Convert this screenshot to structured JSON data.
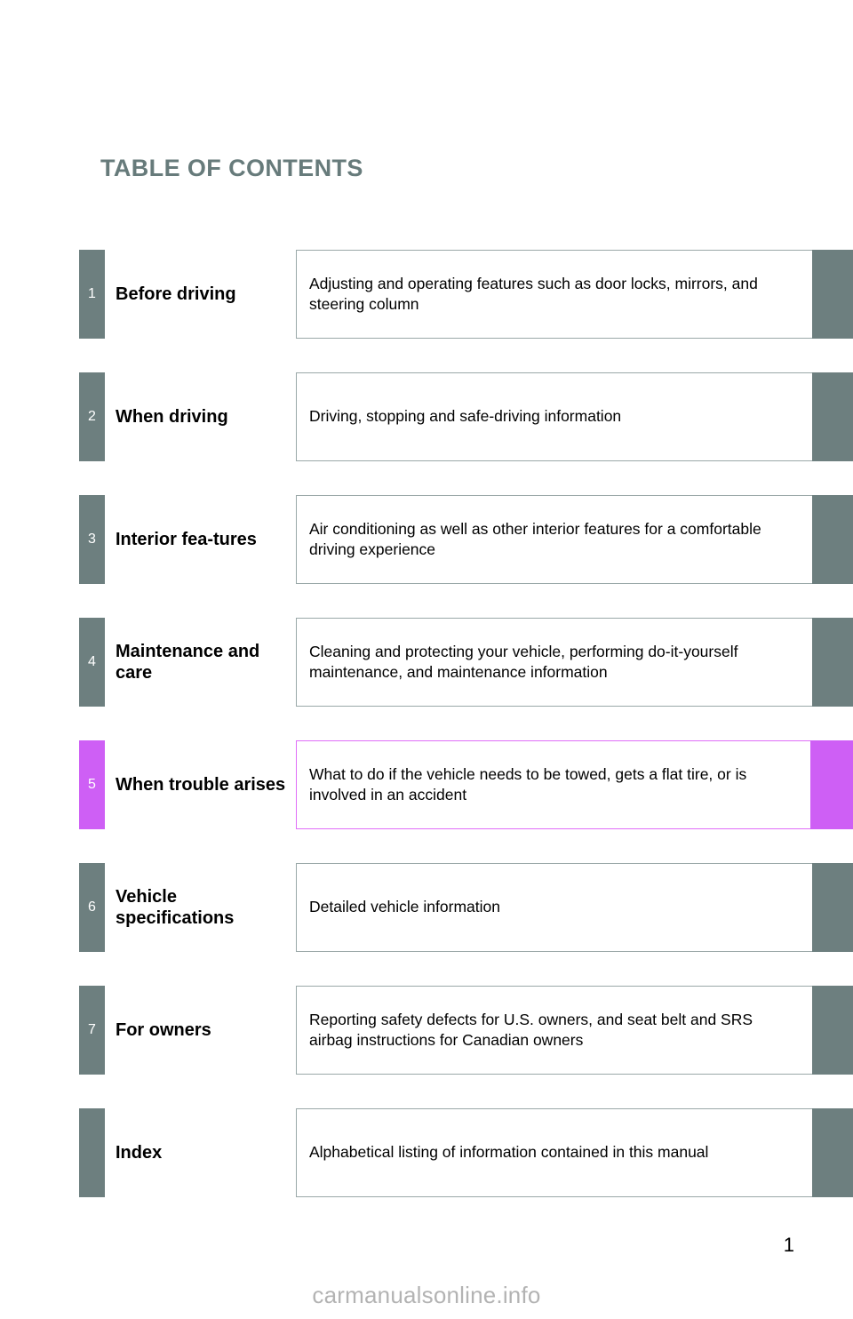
{
  "page": {
    "title": "TABLE OF CONTENTS",
    "number": "1",
    "watermark": "carmanualsonline.info"
  },
  "colors": {
    "tab_gray": "#6d7f7f",
    "tab_highlight": "#ce5ff5",
    "title_gray": "#677b7b",
    "box_border": "#9aa8a8",
    "box_border_highlight": "#e06ef8",
    "text_black": "#000000",
    "watermark_gray": "#b3b3b3"
  },
  "contents": [
    {
      "number": "1",
      "chapter": "Before driving",
      "description": "Adjusting and operating features such as door locks, mirrors, and steering column",
      "highlighted": false
    },
    {
      "number": "2",
      "chapter": "When driving",
      "description": "Driving, stopping and safe-driving information",
      "highlighted": false
    },
    {
      "number": "3",
      "chapter": "Interior fea-tures",
      "description": "Air conditioning as well as other interior features for a comfortable driving experience",
      "highlighted": false
    },
    {
      "number": "4",
      "chapter": "Maintenance and care",
      "description": "Cleaning and protecting your vehicle, performing do-it-yourself maintenance, and maintenance information",
      "highlighted": false
    },
    {
      "number": "5",
      "chapter": "When trouble arises",
      "description": "What to do if the vehicle needs to be towed, gets a flat tire, or is involved in an accident",
      "highlighted": true
    },
    {
      "number": "6",
      "chapter": "Vehicle specifications",
      "description": "Detailed vehicle information",
      "highlighted": false
    },
    {
      "number": "7",
      "chapter": "For owners",
      "description": "Reporting safety defects for U.S. owners, and seat belt and SRS airbag instructions for Canadian owners",
      "highlighted": false
    },
    {
      "number": "",
      "chapter": "Index",
      "description": "Alphabetical listing of information contained in this manual",
      "highlighted": false
    }
  ]
}
